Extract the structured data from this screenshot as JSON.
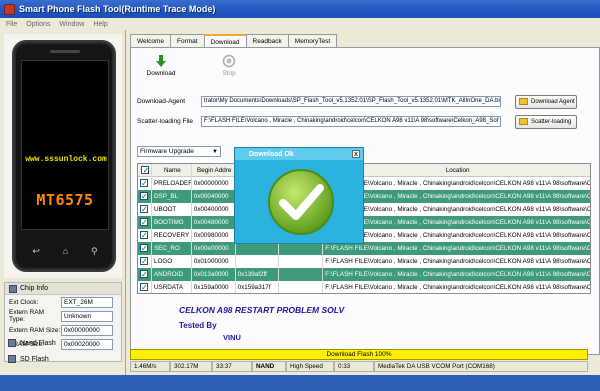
{
  "window": {
    "title": "Smart Phone Flash Tool(Runtime Trace Mode)"
  },
  "menu": [
    "File",
    "Options",
    "Window",
    "Help"
  ],
  "phone": {
    "url": "www.sssunlock.com",
    "chip": "MT6575"
  },
  "chip_info": {
    "header": "Chip Info",
    "rows": [
      {
        "label": "Ext Clock:",
        "value": "EXT_26M"
      },
      {
        "label": "Extern RAM Type:",
        "value": "Unknown"
      },
      {
        "label": "Extern RAM Size:",
        "value": "0x00000000"
      },
      {
        "label": "SRAM Size:",
        "value": "0x00020000"
      }
    ]
  },
  "left_buttons": {
    "nand": "Nand Flash",
    "sd": "SD Flash"
  },
  "tabs": [
    "Welcome",
    "Format",
    "Download",
    "Readback",
    "MemoryTest"
  ],
  "toolbar": {
    "download": "Download",
    "stop": "Stop"
  },
  "download_agent": {
    "label": "Download-Agent",
    "value": "trator\\My Documents\\Downloads\\SP_Flash_Tool_v5.1352.01\\SP_Flash_Tool_v5.1352.01\\MTK_AllInOne_DA.bin",
    "button": "Download Agent"
  },
  "scatter": {
    "label": "Scatter-loading File",
    "value": "F:\\FLASH FILE\\Volcano , Miracle , Chinaking\\android\\celcon\\CELKON A98 v11\\A 98\\software\\Celkon_A98_Sof",
    "button": "Scatter-loading"
  },
  "mode_select": "Firmware Upgrade",
  "table": {
    "headers": [
      "",
      "Name",
      "Begin Addre",
      "",
      "",
      "Location"
    ],
    "rows": [
      {
        "name": "PRELOADER",
        "begin": "0x00000000",
        "end": "",
        "c4": "",
        "location": "F:\\FLASH FILE\\Volcano , Miracle , Chinaking\\android\\celcon\\CELKON A98 v11\\A 98\\software\\Celk..."
      },
      {
        "name": "DSP_BL",
        "begin": "0x00040000",
        "end": "",
        "c4": "",
        "location": "F:\\FLASH FILE\\Volcano , Miracle , Chinaking\\android\\celcon\\CELKON A98 v11\\A 98\\software\\Celk..."
      },
      {
        "name": "UBOOT",
        "begin": "0x00400000",
        "end": "",
        "c4": "",
        "location": "F:\\FLASH FILE\\Volcano , Miracle , Chinaking\\android\\celcon\\CELKON A98 v11\\A 98\\software\\Celk..."
      },
      {
        "name": "BOOTIMG",
        "begin": "0x00480000",
        "end": "",
        "c4": "",
        "location": "F:\\FLASH FILE\\Volcano , Miracle , Chinaking\\android\\celcon\\CELKON A98 v11\\A 98\\software\\Celk..."
      },
      {
        "name": "RECOVERY",
        "begin": "0x00980000",
        "end": "",
        "c4": "",
        "location": "F:\\FLASH FILE\\Volcano , Miracle , Chinaking\\android\\celcon\\CELKON A98 v11\\A 98\\software\\Celk..."
      },
      {
        "name": "SEC_RO",
        "begin": "0x00e00000",
        "end": "",
        "c4": "",
        "location": "F:\\FLASH FILE\\Volcano , Miracle , Chinaking\\android\\celcon\\CELKON A98 v11\\A 98\\software\\Celk..."
      },
      {
        "name": "LOGO",
        "begin": "0x01000000",
        "end": "",
        "c4": "",
        "location": "F:\\FLASH FILE\\Volcano , Miracle , Chinaking\\android\\celcon\\CELKON A98 v11\\A 98\\software\\Celk..."
      },
      {
        "name": "ANDROID",
        "begin": "0x013a0000",
        "end": "0x139af2ff",
        "c4": "",
        "location": "F:\\FLASH FILE\\Volcano , Miracle , Chinaking\\android\\celcon\\CELKON A98 v11\\A 98\\software\\Celk..."
      },
      {
        "name": "USRDATA",
        "begin": "0x159a0000",
        "end": "0x159a317f",
        "c4": "",
        "location": "F:\\FLASH FILE\\Volcano , Miracle , Chinaking\\android\\celcon\\CELKON A98 v11\\A 98\\software\\Celk..."
      }
    ]
  },
  "captions": {
    "line1": "CELKON A98 RESTART PROBLEM SOLV",
    "line2": "Tested By",
    "line3": "VINU"
  },
  "dialog": {
    "title": "Download Ok",
    "close": "x"
  },
  "progress": {
    "label": "Download Flash 100%",
    "fraction": 1.0
  },
  "status": [
    "1.46M/s",
    "302.17M",
    "33:37",
    "NAND",
    "High Speed",
    "0:33",
    "MediaTek DA USB VCOM Port (COM168)"
  ],
  "colors": {
    "table_alt_row": "#3f9a7a",
    "progress": "#ffef00",
    "dialog": "#2bb3e0",
    "check": "#8cc63f"
  }
}
